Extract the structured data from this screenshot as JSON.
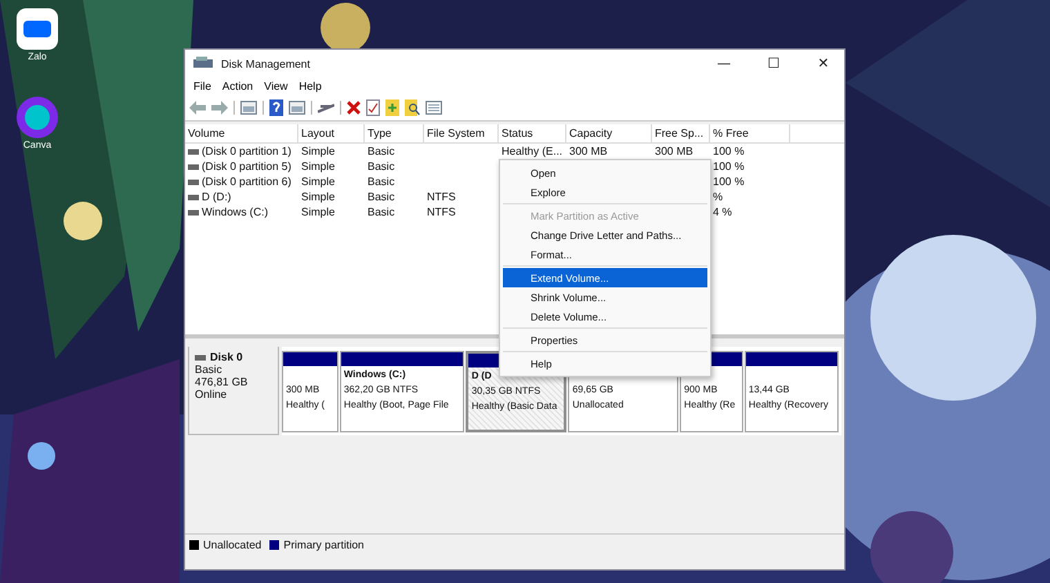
{
  "desktop": {
    "icons": [
      {
        "label": "Zalo",
        "kind": "zalo"
      },
      {
        "label": "Canva",
        "kind": "canva"
      }
    ]
  },
  "window": {
    "title": "Disk Management",
    "controls": [
      "—",
      "☐",
      "✕"
    ]
  },
  "menu_bar": [
    "File",
    "Action",
    "View",
    "Help"
  ],
  "volume_table": {
    "columns": [
      "Volume",
      "Layout",
      "Type",
      "File System",
      "Status",
      "Capacity",
      "Free Sp...",
      "% Free"
    ],
    "rows": [
      [
        "(Disk 0 partition 1)",
        "Simple",
        "Basic",
        "",
        "Healthy (E...",
        "300 MB",
        "300 MB",
        "100 %"
      ],
      [
        "(Disk 0 partition 5)",
        "Simple",
        "Basic",
        "",
        "",
        "",
        "",
        "100 %"
      ],
      [
        "(Disk 0 partition 6)",
        "Simple",
        "Basic",
        "",
        "",
        "",
        "",
        "100 %"
      ],
      [
        "D (D:)",
        "Simple",
        "Basic",
        "NTFS",
        "",
        "",
        "",
        "%"
      ],
      [
        "Windows (C:)",
        "Simple",
        "Basic",
        "NTFS",
        "",
        "",
        "",
        "4 %"
      ]
    ]
  },
  "disk": {
    "name": "Disk 0",
    "type": "Basic",
    "size": "476,81 GB",
    "status": "Online",
    "partitions": [
      {
        "kind": "primary",
        "size": "300 MB",
        "status": "Healthy (",
        "selected": false
      },
      {
        "kind": "primary",
        "name": "Windows  (C:)",
        "size": "362,20 GB NTFS",
        "status": "Healthy (Boot, Page File",
        "selected": false
      },
      {
        "kind": "primary",
        "name": "D  (D",
        "size": "30,35 GB NTFS",
        "status": "Healthy (Basic Data",
        "selected": true
      },
      {
        "kind": "unallocated",
        "size": "69,65 GB",
        "status": "Unallocated",
        "selected": false
      },
      {
        "kind": "primary",
        "size": "900 MB",
        "status": "Healthy (Re",
        "selected": false
      },
      {
        "kind": "primary",
        "size": "13,44 GB",
        "status": "Healthy (Recovery",
        "selected": false
      }
    ]
  },
  "legend": [
    {
      "label": "Unallocated",
      "color": "#000000"
    },
    {
      "label": "Primary partition",
      "color": "#000080"
    }
  ],
  "context_menu": [
    {
      "kind": "item",
      "label": "Open",
      "disabled": false,
      "selected": false
    },
    {
      "kind": "item",
      "label": "Explore",
      "disabled": false,
      "selected": false
    },
    {
      "kind": "separator"
    },
    {
      "kind": "item",
      "label": "Mark Partition as Active",
      "disabled": true,
      "selected": false
    },
    {
      "kind": "item",
      "label": "Change Drive Letter and Paths...",
      "disabled": false,
      "selected": false
    },
    {
      "kind": "item",
      "label": "Format...",
      "disabled": false,
      "selected": false
    },
    {
      "kind": "separator"
    },
    {
      "kind": "item",
      "label": "Extend Volume...",
      "disabled": false,
      "selected": true
    },
    {
      "kind": "item",
      "label": "Shrink Volume...",
      "disabled": false,
      "selected": false
    },
    {
      "kind": "item",
      "label": "Delete Volume...",
      "disabled": false,
      "selected": false
    },
    {
      "kind": "separator"
    },
    {
      "kind": "item",
      "label": "Properties",
      "disabled": false,
      "selected": false
    },
    {
      "kind": "separator"
    },
    {
      "kind": "item",
      "label": "Help",
      "disabled": false,
      "selected": false
    }
  ]
}
